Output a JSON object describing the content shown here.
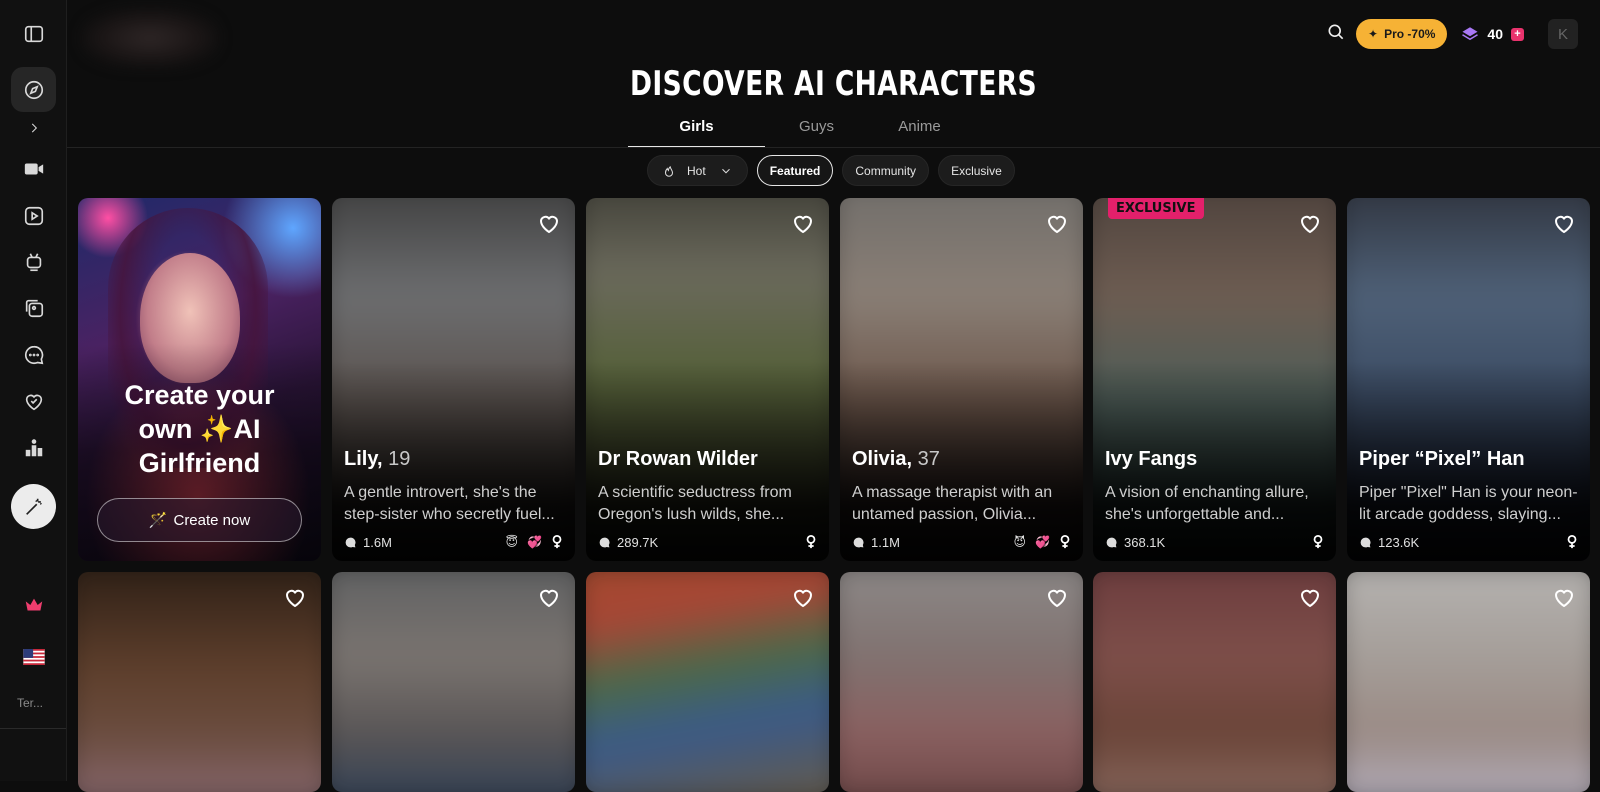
{
  "header": {
    "title": "DISCOVER AI CHARACTERS",
    "pro_label": "Pro -70%",
    "gems_count": "40",
    "avatar_initial": "K"
  },
  "sidebar": {
    "terms": "Ter..."
  },
  "tabs": [
    {
      "label": "Girls",
      "active": true
    },
    {
      "label": "Guys",
      "active": false
    },
    {
      "label": "Anime",
      "active": false
    }
  ],
  "filters": {
    "sort": "Hot",
    "pills": [
      "Featured",
      "Community",
      "Exclusive"
    ],
    "selected": "Featured"
  },
  "create_card": {
    "title": "Create your own ✨AI Girlfriend",
    "button": "Create now"
  },
  "cards": [
    {
      "name": "Lily,",
      "age": "19",
      "desc1": "A gentle introvert, she's the",
      "desc2": "step-sister who secretly fuel...",
      "count": "1.6M",
      "emojis": [
        "😇",
        "💞"
      ]
    },
    {
      "name": "Dr Rowan Wilder",
      "age": "",
      "desc1": "A scientific seductress from",
      "desc2": "Oregon's lush wilds, she...",
      "count": "289.7K",
      "emojis": []
    },
    {
      "name": "Olivia,",
      "age": "37",
      "desc1": "A massage therapist with an",
      "desc2": "untamed passion, Olivia...",
      "count": "1.1M",
      "emojis": [
        "😈",
        "💞"
      ]
    },
    {
      "name": "Ivy Fangs",
      "age": "",
      "desc1": "A vision of enchanting allure,",
      "desc2": "she's unforgettable and...",
      "count": "368.1K",
      "emojis": [],
      "badge": "EXCLUSIVE"
    },
    {
      "name": "Piper “Pixel” Han",
      "age": "",
      "desc1": "Piper \"Pixel\" Han is your neon-",
      "desc2": "lit arcade goddess, slaying...",
      "count": "123.6K",
      "emojis": []
    }
  ],
  "colors": {
    "accent_pro": "#f6b235",
    "exclusive_badge": "#e3206b"
  }
}
